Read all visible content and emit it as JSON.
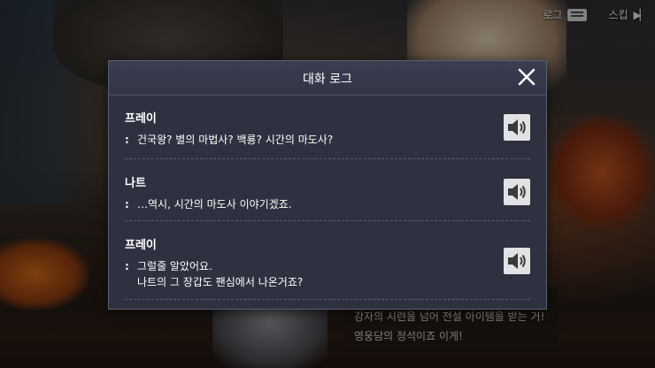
{
  "hud": {
    "log_label": "로그",
    "skip_label": "스킵"
  },
  "background_dialogue": {
    "lines": [
      "강자의 시련을 넘어 전설 아이템을 받는 거!",
      "영웅담의 정석이죠 이게!"
    ]
  },
  "dialog": {
    "title": "대화 로그",
    "entries": [
      {
        "speaker": "프레이",
        "colon": ":",
        "lines": [
          "건국왕? 별의 마법사? 백룡? 시간의 마도사?"
        ]
      },
      {
        "speaker": "나트",
        "colon": ":",
        "lines": [
          "…역시, 시간의 마도사 이야기겠죠."
        ]
      },
      {
        "speaker": "프레이",
        "colon": ":",
        "lines": [
          "그럴줄 알았어요.",
          "나트의 그 장갑도 팬심에서 나온거죠?"
        ]
      }
    ]
  },
  "icons": {
    "close": "close-icon",
    "voice": "speaker-volume-icon",
    "log": "chat-log-icon",
    "skip": "skip-forward-icon"
  },
  "colors": {
    "dialog_bg": "#2e3140",
    "dialog_border": "#5a5f70",
    "voice_button_bg": "#e2e2e4",
    "text": "#ffffff"
  }
}
